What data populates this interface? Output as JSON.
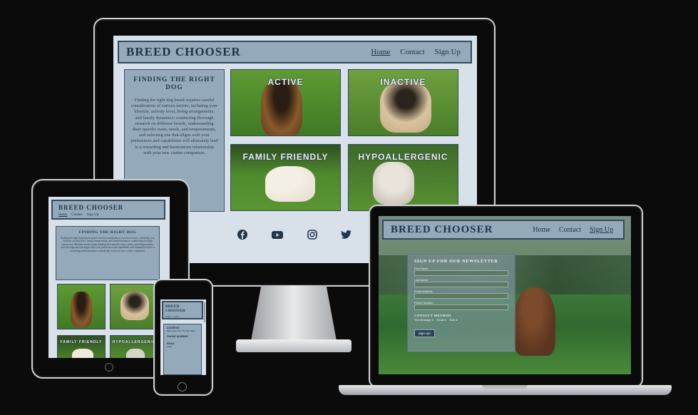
{
  "brand": "BREED CHOOSER",
  "nav": {
    "home": "Home",
    "contact": "Contact",
    "signup": "Sign Up"
  },
  "intro": {
    "title": "FINDING THE RIGHT DOG",
    "body": "Finding the right dog breed requires careful consideration of various factors, including your lifestyle, activity level, living arrangements, and family dynamics; conducting thorough research on different breeds, understanding their specific traits, needs, and temperaments, and selecting one that aligns with your preferences and capabilities will ultimately lead to a rewarding and harmonious relationship with your new canine companion."
  },
  "cards": {
    "active": "ACTIVE",
    "inactive": "INACTIVE",
    "family": "FAMILY FRIENDLY",
    "hypo": "HYPOALLERGENIC"
  },
  "social": [
    "facebook-icon",
    "youtube-icon",
    "instagram-icon",
    "twitter-icon"
  ],
  "newsletter": {
    "title": "SIGN UP FOR OUR NEWSLETTER",
    "first_name": "First Name",
    "last_name": "Last Name",
    "email": "Email Address",
    "phone": "Phone Number",
    "method_title": "CONTACT METHOD",
    "text_opt": "Text Message",
    "email_opt": "Email",
    "both_opt": "Both",
    "submit": "Sign Up!"
  },
  "phone_contact": {
    "address_title": "ADDRESS",
    "address_value": "Bakerygate 123, The Bay Valley",
    "phone_title": "PHONE NUMBER",
    "email_title": "EMAIL",
    "email_value": "Email"
  },
  "colors": {
    "header": "#94a9b9",
    "border": "#33495e",
    "text": "#20344a",
    "page": "#d8e1ea",
    "grass": "#4f8a2e"
  }
}
